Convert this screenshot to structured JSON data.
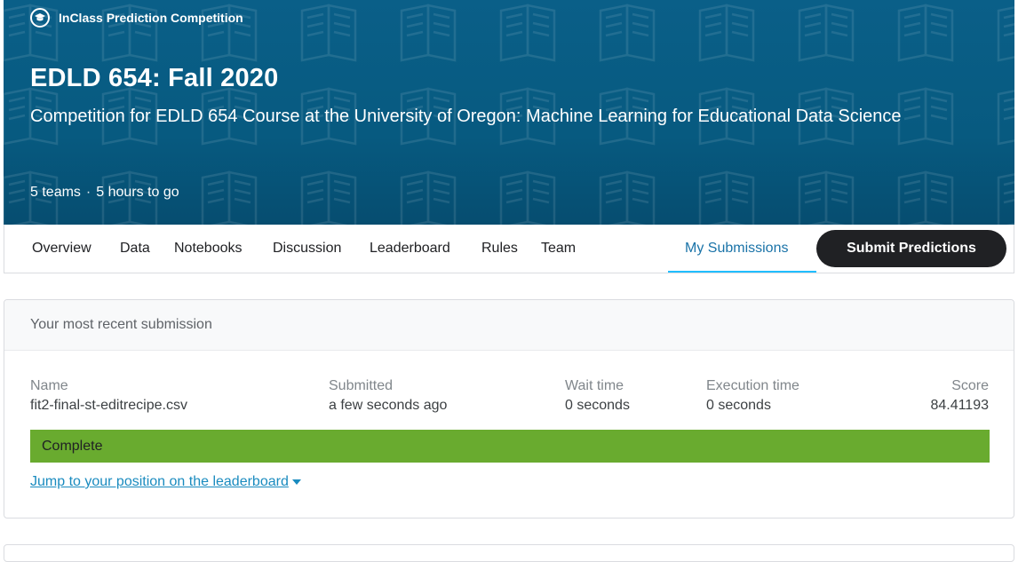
{
  "competition": {
    "type_label": "InClass Prediction Competition",
    "title": "EDLD 654: Fall 2020",
    "subtitle": "Competition for EDLD 654 Course at the University of Oregon: Machine Learning for Educational Data Science",
    "teams": "5 teams",
    "separator": "·",
    "time_left": "5 hours to go",
    "header_color": "#0a5f88"
  },
  "tabs": {
    "overview": "Overview",
    "data": "Data",
    "notebooks": "Notebooks",
    "discussion": "Discussion",
    "leaderboard": "Leaderboard",
    "rules": "Rules",
    "team": "Team",
    "my_submissions": "My Submissions",
    "active": "My Submissions"
  },
  "submit_button": "Submit Predictions",
  "recent_submission": {
    "heading": "Your most recent submission",
    "name_label": "Name",
    "name_value": "fit2-final-st-editrecipe.csv",
    "submitted_label": "Submitted",
    "submitted_value": "a few seconds ago",
    "wait_label": "Wait time",
    "wait_value": "0 seconds",
    "execution_label": "Execution time",
    "execution_value": "0 seconds",
    "score_label": "Score",
    "score_value": "84.41193",
    "status": "Complete",
    "status_color": "#69ab2f",
    "jump_link": "Jump to your position on the leaderboard"
  },
  "icons": {
    "competition_type": "graduation-cap-icon",
    "jump_caret": "caret-down-icon",
    "header_pattern": "open-book-pattern"
  }
}
